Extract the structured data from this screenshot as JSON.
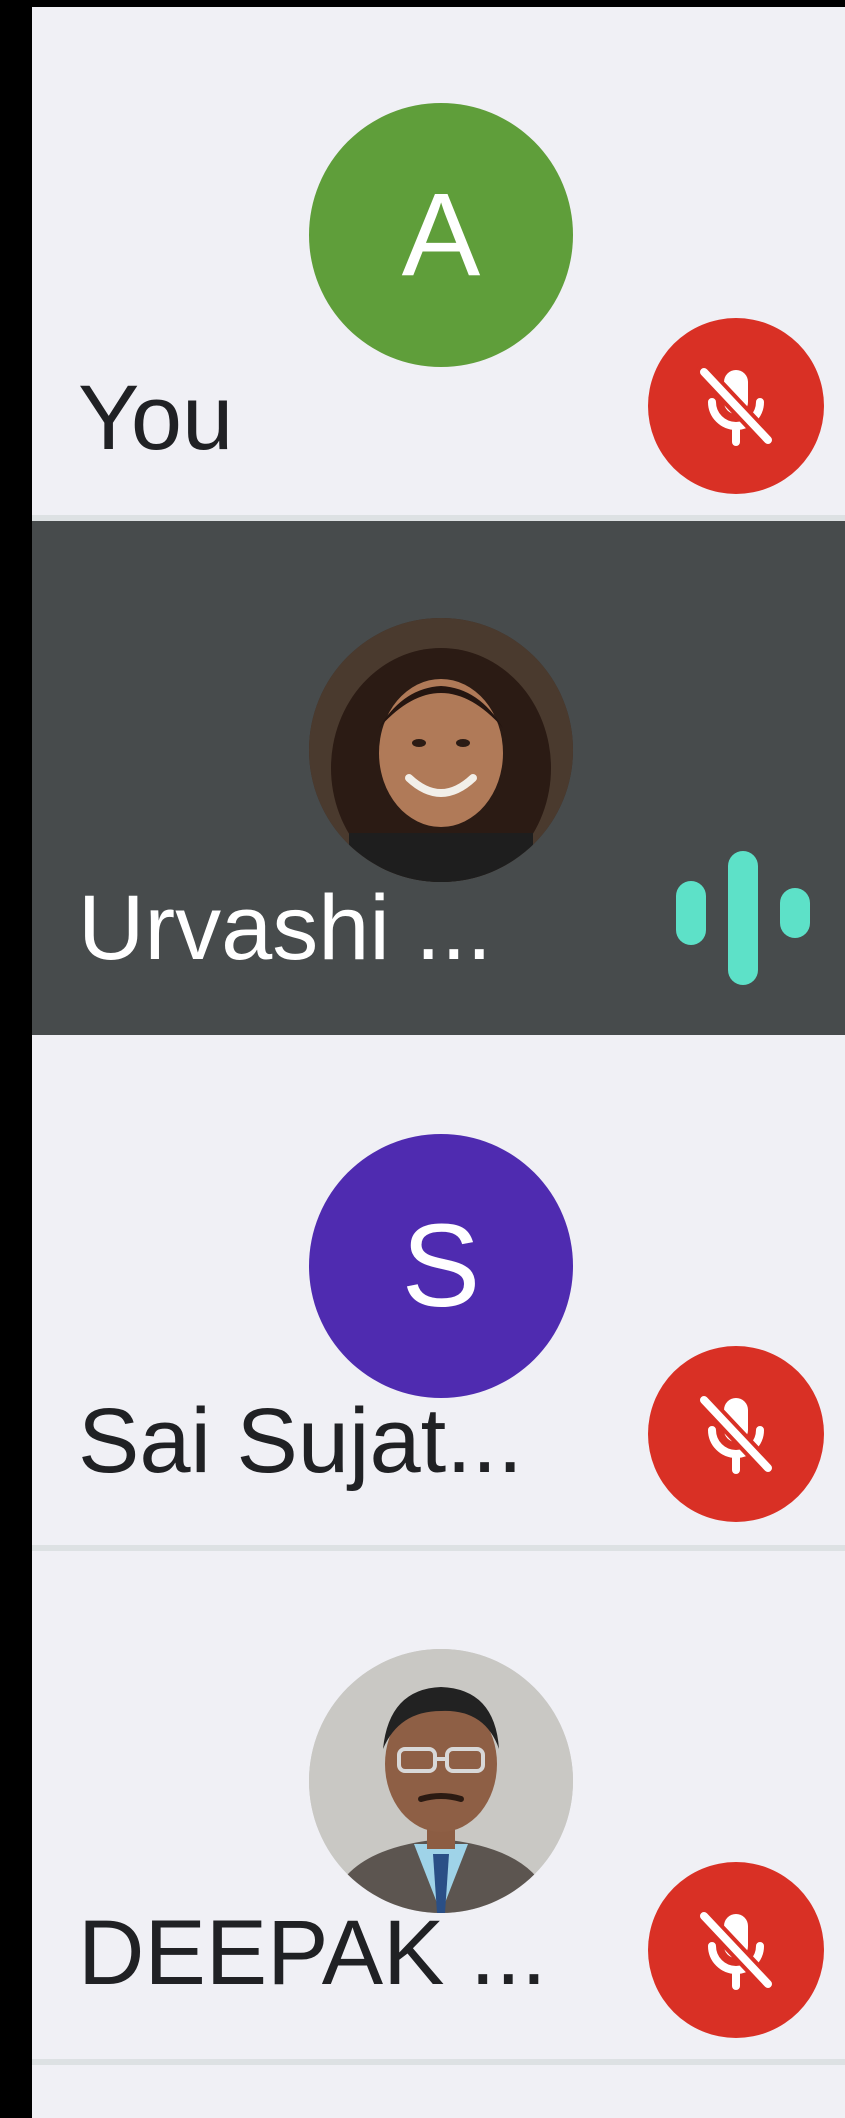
{
  "colors": {
    "tile_background": "#f0f0f5",
    "active_tile_background": "#474b4c",
    "muted_red": "#d93025",
    "speaking_indicator": "#5de1c8",
    "avatar_a": "#5f9e3a",
    "avatar_s": "#4f2bb0"
  },
  "participants": [
    {
      "name": "You",
      "avatar_type": "initial",
      "avatar_initial": "A",
      "avatar_color": "#5f9e3a",
      "status": "muted",
      "status_icon": "mic-off-icon"
    },
    {
      "name": "Urvashi ...",
      "avatar_type": "photo",
      "status": "speaking",
      "status_icon": "audio-level-icon"
    },
    {
      "name": "Sai Sujat...",
      "avatar_type": "initial",
      "avatar_initial": "S",
      "avatar_color": "#4f2bb0",
      "status": "muted",
      "status_icon": "mic-off-icon"
    },
    {
      "name": "DEEPAK ...",
      "avatar_type": "photo",
      "status": "muted",
      "status_icon": "mic-off-icon"
    }
  ]
}
